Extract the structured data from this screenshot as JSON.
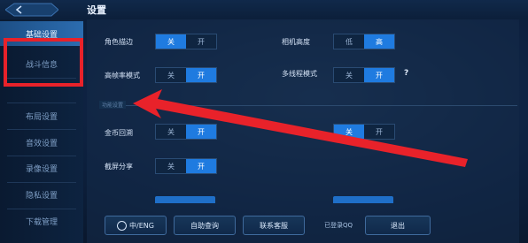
{
  "header": {
    "title": "设置"
  },
  "sidebar": {
    "items": [
      {
        "label": "基础设置",
        "active": true
      },
      {
        "label": "战斗信息",
        "active": false
      },
      {
        "label": "",
        "active": false
      },
      {
        "label": "布局设置",
        "active": false
      },
      {
        "label": "音效设置",
        "active": false
      },
      {
        "label": "录像设置",
        "active": false
      },
      {
        "label": "隐私设置",
        "active": false
      },
      {
        "label": "下载管理",
        "active": false
      }
    ]
  },
  "settings": {
    "role_stroke": {
      "label": "角色描边",
      "options": [
        "关",
        "开"
      ],
      "selected": "关"
    },
    "camera_height": {
      "label": "相机高度",
      "options": [
        "低",
        "高"
      ],
      "selected": "高"
    },
    "high_frame": {
      "label": "高帧率模式",
      "options": [
        "关",
        "开"
      ],
      "selected": "开"
    },
    "multithread": {
      "label": "多线程模式",
      "sublabel": "",
      "options": [
        "关",
        "开"
      ],
      "selected": "开",
      "help": "?"
    },
    "section_title": "功能设置",
    "coin_back": {
      "label": "金币回溯",
      "options": [
        "关",
        "开"
      ],
      "selected": "开"
    },
    "fast_push": {
      "label": "",
      "options": [
        "关",
        "开"
      ],
      "selected": "关"
    },
    "screenshot_share": {
      "label": "截屏分享",
      "options": [
        "关",
        "开"
      ],
      "selected": "开"
    }
  },
  "bottom": {
    "lang_button": "中/ENG",
    "self_query_button": "自助查询",
    "support_button": "联系客服",
    "qq_status": "已登录QQ",
    "logout_button": "退出"
  },
  "colors": {
    "accent": "#1f7be0",
    "annotation": "#e8222a"
  }
}
